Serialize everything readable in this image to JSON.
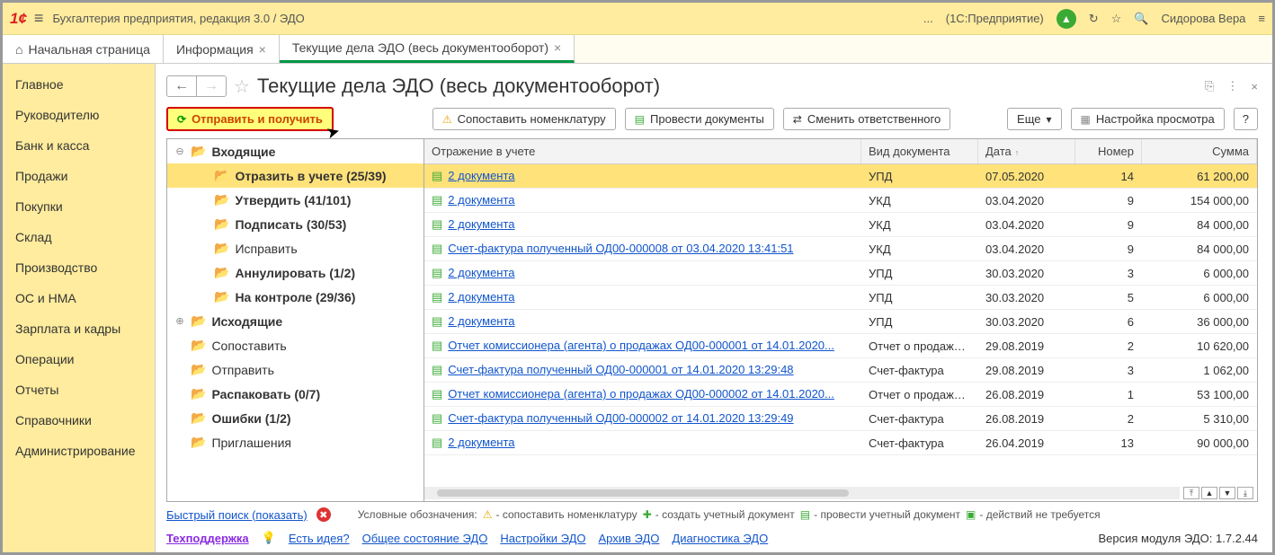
{
  "titlebar": {
    "title": "Бухгалтерия предприятия, редакция 3.0 / ЭДО",
    "mode": "(1С:Предприятие)",
    "ellipsis": "...",
    "user": "Сидорова Вера"
  },
  "tabs": {
    "home": "Начальная страница",
    "info": "Информация",
    "edo": "Текущие дела ЭДО (весь документооборот)"
  },
  "leftnav": [
    "Главное",
    "Руководителю",
    "Банк и касса",
    "Продажи",
    "Покупки",
    "Склад",
    "Производство",
    "ОС и НМА",
    "Зарплата и кадры",
    "Операции",
    "Отчеты",
    "Справочники",
    "Администрирование"
  ],
  "heading": "Текущие дела ЭДО (весь документооборот)",
  "toolbar": {
    "send": "Отправить и получить",
    "match": "Сопоставить номенклатуру",
    "post": "Провести документы",
    "owner": "Сменить ответственного",
    "more": "Еще",
    "view": "Настройка просмотра",
    "help": "?"
  },
  "tree": [
    {
      "lvl": 1,
      "exp": "⊖",
      "bold": true,
      "label": "Входящие"
    },
    {
      "lvl": 2,
      "bold": true,
      "sel": true,
      "label": "Отразить в учете (25/39)"
    },
    {
      "lvl": 2,
      "bold": true,
      "label": "Утвердить (41/101)"
    },
    {
      "lvl": 2,
      "bold": true,
      "label": "Подписать (30/53)"
    },
    {
      "lvl": 2,
      "label": "Исправить"
    },
    {
      "lvl": 2,
      "bold": true,
      "label": "Аннулировать (1/2)"
    },
    {
      "lvl": 2,
      "bold": true,
      "label": "На контроле (29/36)"
    },
    {
      "lvl": 1,
      "exp": "⊕",
      "bold": true,
      "label": "Исходящие"
    },
    {
      "lvl": 1,
      "label": "Сопоставить"
    },
    {
      "lvl": 1,
      "label": "Отправить"
    },
    {
      "lvl": 1,
      "bold": true,
      "label": "Распаковать (0/7)"
    },
    {
      "lvl": 1,
      "bold": true,
      "label": "Ошибки (1/2)"
    },
    {
      "lvl": 1,
      "label": "Приглашения"
    }
  ],
  "columns": {
    "a": "Отражение в учете",
    "b": "Вид документа",
    "c": "Дата",
    "d": "Номер",
    "e": "Сумма"
  },
  "rows": [
    {
      "a": "2 документа",
      "b": "УПД",
      "c": "07.05.2020",
      "d": "14",
      "e": "61 200,00",
      "sel": true
    },
    {
      "a": "2 документа",
      "b": "УКД",
      "c": "03.04.2020",
      "d": "9",
      "e": "154 000,00"
    },
    {
      "a": "2 документа",
      "b": "УКД",
      "c": "03.04.2020",
      "d": "9",
      "e": "84 000,00"
    },
    {
      "a": "Счет-фактура полученный ОД00-000008 от 03.04.2020 13:41:51",
      "b": "УКД",
      "c": "03.04.2020",
      "d": "9",
      "e": "84 000,00"
    },
    {
      "a": "2 документа",
      "b": "УПД",
      "c": "30.03.2020",
      "d": "3",
      "e": "6 000,00"
    },
    {
      "a": "2 документа",
      "b": "УПД",
      "c": "30.03.2020",
      "d": "5",
      "e": "6 000,00"
    },
    {
      "a": "2 документа",
      "b": "УПД",
      "c": "30.03.2020",
      "d": "6",
      "e": "36 000,00"
    },
    {
      "a": "Отчет комиссионера (агента) о продажах ОД00-000001 от 14.01.2020...",
      "b": "Отчет о продажах...",
      "c": "29.08.2019",
      "d": "2",
      "e": "10 620,00"
    },
    {
      "a": "Счет-фактура полученный ОД00-000001 от 14.01.2020 13:29:48",
      "b": "Счет-фактура",
      "c": "29.08.2019",
      "d": "3",
      "e": "1 062,00"
    },
    {
      "a": "Отчет комиссионера (агента) о продажах ОД00-000002 от 14.01.2020...",
      "b": "Отчет о продажах...",
      "c": "26.08.2019",
      "d": "1",
      "e": "53 100,00"
    },
    {
      "a": "Счет-фактура полученный ОД00-000002 от 14.01.2020 13:29:49",
      "b": "Счет-фактура",
      "c": "26.08.2019",
      "d": "2",
      "e": "5 310,00"
    },
    {
      "a": "2 документа",
      "b": "Счет-фактура",
      "c": "26.04.2019",
      "d": "13",
      "e": "90 000,00"
    }
  ],
  "footer1": {
    "quick": "Быстрый поиск (показать)",
    "legend_label": "Условные обозначения:",
    "leg1": "- сопоставить номенклатуру",
    "leg2": "- создать учетный документ",
    "leg3": "- провести учетный документ",
    "leg4": "- действий не требуется"
  },
  "footer2": {
    "support": "Техподдержка",
    "idea": "Есть идея?",
    "l1": "Общее состояние ЭДО",
    "l2": "Настройки ЭДО",
    "l3": "Архив ЭДО",
    "l4": "Диагностика ЭДО",
    "version": "Версия модуля ЭДО: 1.7.2.44"
  }
}
